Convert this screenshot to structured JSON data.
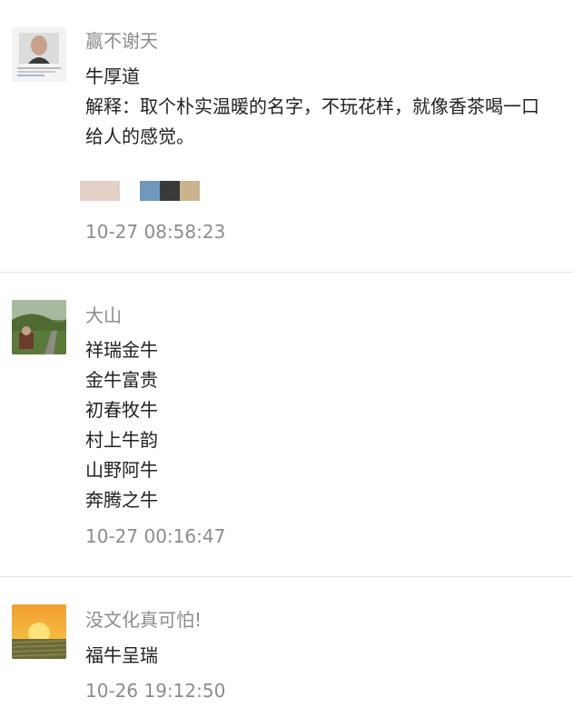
{
  "comments": [
    {
      "nickname": "赢不谢天",
      "lines": [
        "牛厚道",
        "解释：取个朴实温暖的名字，不玩花样，就像香茶喝一口",
        "给人的感觉。"
      ],
      "time": "10-27 08:58:23"
    },
    {
      "nickname": "大山",
      "lines": [
        "祥瑞金牛",
        "金牛富贵",
        "初春牧牛",
        "村上牛韵",
        "山野阿牛",
        "奔腾之牛"
      ],
      "time": "10-27 00:16:47"
    },
    {
      "nickname": "没文化真可怕!",
      "lines": [
        "福牛呈瑞"
      ],
      "time": "10-26 19:12:50"
    }
  ],
  "colors": {
    "nickname": "#8c8c8c",
    "text": "#222222",
    "divider": "#e5e5e5"
  }
}
